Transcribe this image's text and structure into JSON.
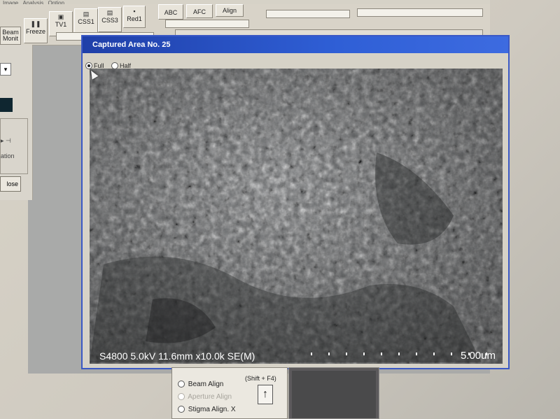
{
  "menu": {
    "items": [
      "Image",
      "Analysis",
      "Option"
    ]
  },
  "toolbar": {
    "buttons": [
      "Beam\nMonit",
      "Freeze",
      "TV1",
      "CSS1",
      "CSS3",
      "Red1",
      "ABC",
      "AFC",
      "Align"
    ]
  },
  "left_panel": {
    "dropdown_value": "",
    "label": "ation",
    "close_label": "lose"
  },
  "window": {
    "title": "Captured Area No. 25",
    "radio_full": "Full",
    "radio_half": "Half",
    "selected": "Full"
  },
  "sem": {
    "caption": "S4800 5.0kV 11.6mm x10.0k SE(M)",
    "scale_label": "5.00um"
  },
  "align_panel": {
    "shortcut": "(Shift + F4)",
    "items": [
      "Beam  Align",
      "Aperture Align",
      "Stigma Align. X"
    ],
    "selected": "Beam  Align",
    "up_arrow": "↑"
  },
  "colors": {
    "titlebar": "#2f5fd6",
    "window_border": "#3b59c5",
    "sem_background": "#6b6d6f"
  }
}
